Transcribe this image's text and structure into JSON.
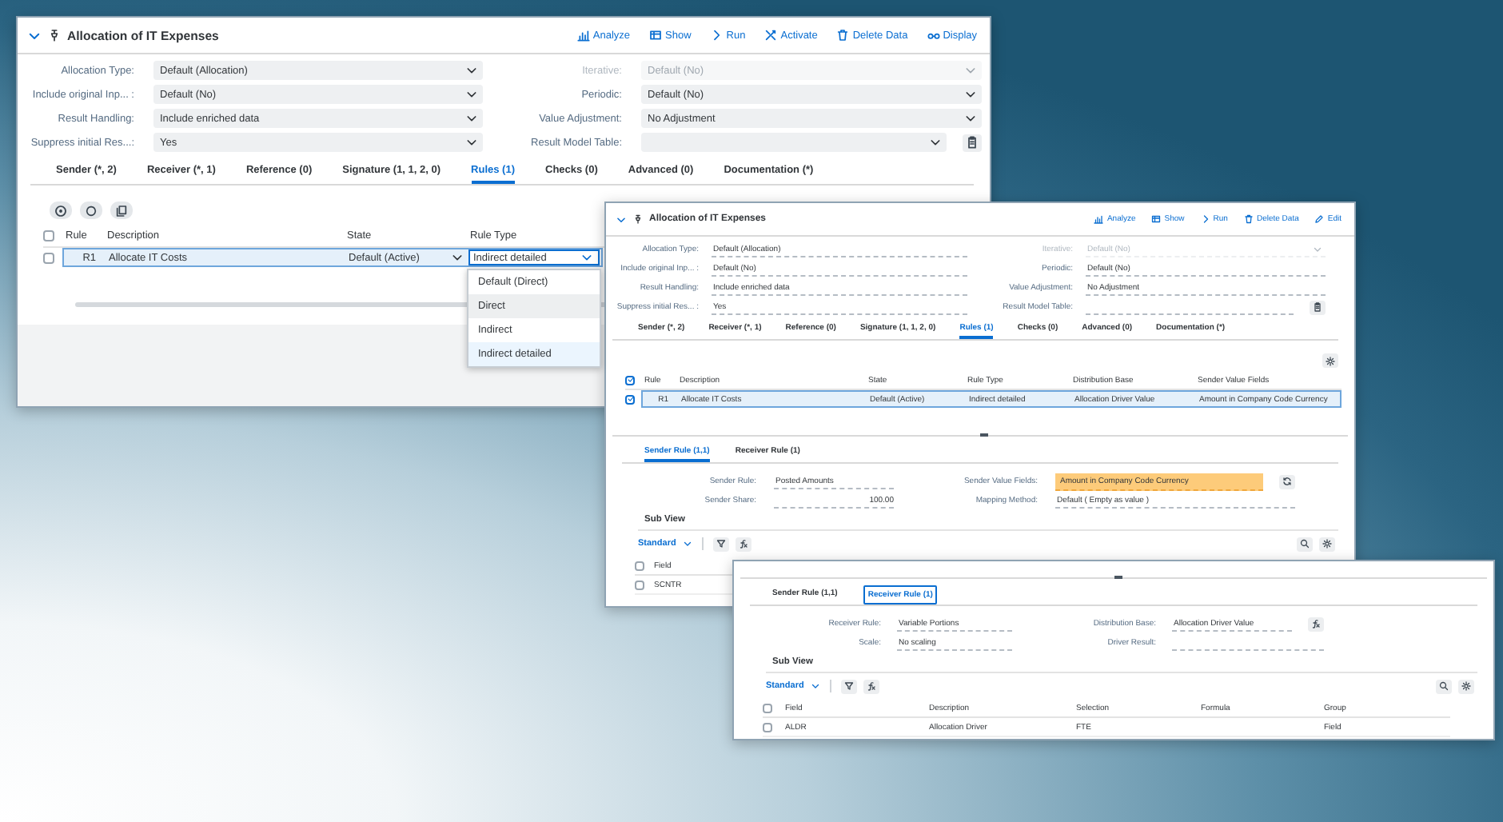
{
  "main_window": {
    "title": "Allocation of IT Expenses",
    "actions": [
      "Analyze",
      "Show",
      "Run",
      "Activate",
      "Delete Data",
      "Display"
    ],
    "form": {
      "left": [
        {
          "label": "Allocation Type:",
          "value": "Default (Allocation)",
          "disabled": false,
          "kind": "select"
        },
        {
          "label": "Include original Inp... :",
          "value": "Default (No)",
          "disabled": false,
          "kind": "select"
        },
        {
          "label": "Result Handling:",
          "value": "Include enriched data",
          "disabled": false,
          "kind": "select"
        },
        {
          "label": "Suppress initial Res...:",
          "value": "Yes",
          "disabled": false,
          "kind": "select"
        }
      ],
      "right": [
        {
          "label": "Iterative:",
          "value": "Default (No)",
          "disabled": true,
          "kind": "select"
        },
        {
          "label": "Periodic:",
          "value": "Default (No)",
          "disabled": false,
          "kind": "select"
        },
        {
          "label": "Value Adjustment:",
          "value": "No Adjustment",
          "disabled": false,
          "kind": "select"
        },
        {
          "label": "Result Model Table:",
          "disabled": false,
          "kind": "select_button"
        }
      ]
    },
    "tabs": [
      {
        "label": "Sender (*, 2)",
        "selected": false
      },
      {
        "label": "Receiver (*, 1)",
        "selected": false
      },
      {
        "label": "Reference (0)",
        "selected": false
      },
      {
        "label": "Signature (1, 1, 2, 0)",
        "selected": false
      },
      {
        "label": "Rules (1)",
        "selected": true
      },
      {
        "label": "Checks (0)",
        "selected": false
      },
      {
        "label": "Advanced (0)",
        "selected": false
      },
      {
        "label": "Documentation (*)",
        "selected": false
      }
    ],
    "rules_table": {
      "all_checked": false,
      "columns": [
        "Rule",
        "Description",
        "State",
        "Rule Type"
      ],
      "rows": [
        {
          "checked": false,
          "cells": [
            "R1",
            "Allocate IT Costs",
            "Default (Active)",
            "Indirect detailed"
          ]
        }
      ]
    },
    "rule_type_dropdown": {
      "options": [
        {
          "label": "Default (Direct)",
          "selected": false,
          "hovered": false
        },
        {
          "label": "Direct",
          "selected": false,
          "hovered": true
        },
        {
          "label": "Indirect",
          "selected": false,
          "hovered": false
        },
        {
          "label": "Indirect detailed",
          "selected": true,
          "hovered": false
        }
      ]
    }
  },
  "detail_window": {
    "title": "Allocation of IT Expenses",
    "actions": [
      "Analyze",
      "Show",
      "Run",
      "Delete Data",
      "Edit"
    ],
    "form": {
      "left": [
        {
          "label": "Allocation Type:",
          "value": "Default (Allocation)",
          "disabled": false,
          "kind": "text"
        },
        {
          "label": "Include original Inp... :",
          "value": "Default (No)",
          "disabled": false,
          "kind": "text"
        },
        {
          "label": "Result Handling:",
          "value": "Include enriched data",
          "disabled": false,
          "kind": "text"
        },
        {
          "label": "Suppress initial Res... :",
          "value": "Yes",
          "disabled": false,
          "kind": "text"
        }
      ],
      "right": [
        {
          "label": "Iterative:",
          "value": "Default (No)",
          "disabled": true,
          "kind": "select"
        },
        {
          "label": "Periodic:",
          "value": "Default (No)",
          "disabled": false,
          "kind": "text"
        },
        {
          "label": "Value Adjustment:",
          "value": "No Adjustment",
          "disabled": false,
          "kind": "text"
        },
        {
          "label": "Result Model Table:",
          "disabled": false,
          "kind": "text_button"
        }
      ]
    },
    "tabs": [
      {
        "label": "Sender (*, 2)",
        "selected": false
      },
      {
        "label": "Receiver (*, 1)",
        "selected": false
      },
      {
        "label": "Reference (0)",
        "selected": false
      },
      {
        "label": "Signature (1, 1, 2, 0)",
        "selected": false
      },
      {
        "label": "Rules (1)",
        "selected": true
      },
      {
        "label": "Checks (0)",
        "selected": false
      },
      {
        "label": "Advanced (0)",
        "selected": false
      },
      {
        "label": "Documentation (*)",
        "selected": false
      }
    ],
    "rules_table": {
      "all_checked": true,
      "columns": [
        "Rule",
        "Description",
        "State",
        "Rule Type",
        "Distribution Base",
        "Sender Value Fields"
      ],
      "rows": [
        {
          "checked": true,
          "cells": [
            "R1",
            "Allocate IT Costs",
            "Default (Active)",
            "Indirect detailed",
            "Allocation Driver Value",
            "Amount in Company Code Currency"
          ]
        }
      ]
    },
    "rule_tabs": [
      {
        "label": "Sender Rule (1,1)",
        "selected": true
      },
      {
        "label": "Receiver Rule (1)",
        "selected": false
      }
    ],
    "rule_form": {
      "left": [
        {
          "label": "Sender Rule:",
          "value": "Posted Amounts",
          "numeric": false,
          "highlighted": false,
          "kind": "text"
        },
        {
          "label": "Sender Share:",
          "value": "100.00",
          "numeric": true,
          "highlighted": false,
          "kind": "text"
        }
      ],
      "right": [
        {
          "label": "Sender Value Fields:",
          "value": "Amount in Company Code Currency",
          "numeric": false,
          "highlighted": true,
          "kind": "text_button"
        },
        {
          "label": "Mapping Method:",
          "value": "Default ( Empty as value )",
          "numeric": false,
          "highlighted": false,
          "kind": "text"
        }
      ]
    },
    "sub_view": {
      "title": "Sub View",
      "variant": "Standard",
      "all_checked": false,
      "columns": [
        "Field"
      ],
      "rows": [
        {
          "checked": false,
          "cells": [
            "SCNTR"
          ]
        }
      ]
    }
  },
  "receiver_window": {
    "rule_tabs": [
      {
        "label": "Sender Rule (1,1)",
        "selected": false
      },
      {
        "label": "Receiver Rule (1)",
        "selected": true
      }
    ],
    "rule_form": {
      "left": [
        {
          "label": "Receiver Rule:",
          "value": "Variable Portions",
          "numeric": false,
          "highlighted": false,
          "kind": "text"
        },
        {
          "label": "Scale:",
          "value": "No scaling",
          "numeric": false,
          "highlighted": false,
          "kind": "text"
        }
      ],
      "right": [
        {
          "label": "Distribution Base:",
          "value": "Allocation Driver Value",
          "numeric": false,
          "highlighted": false,
          "kind": "text_button"
        },
        {
          "label": "Driver Result:",
          "highlighted": false,
          "kind": "text"
        }
      ]
    },
    "sub_view": {
      "title": "Sub View",
      "variant": "Standard",
      "all_checked": false,
      "columns": [
        "Field",
        "Description",
        "Selection",
        "Formula",
        "Group"
      ],
      "rows": [
        {
          "checked": false,
          "cells": [
            "ALDR",
            "Allocation Driver",
            "FTE",
            null,
            "Field"
          ]
        }
      ]
    }
  }
}
